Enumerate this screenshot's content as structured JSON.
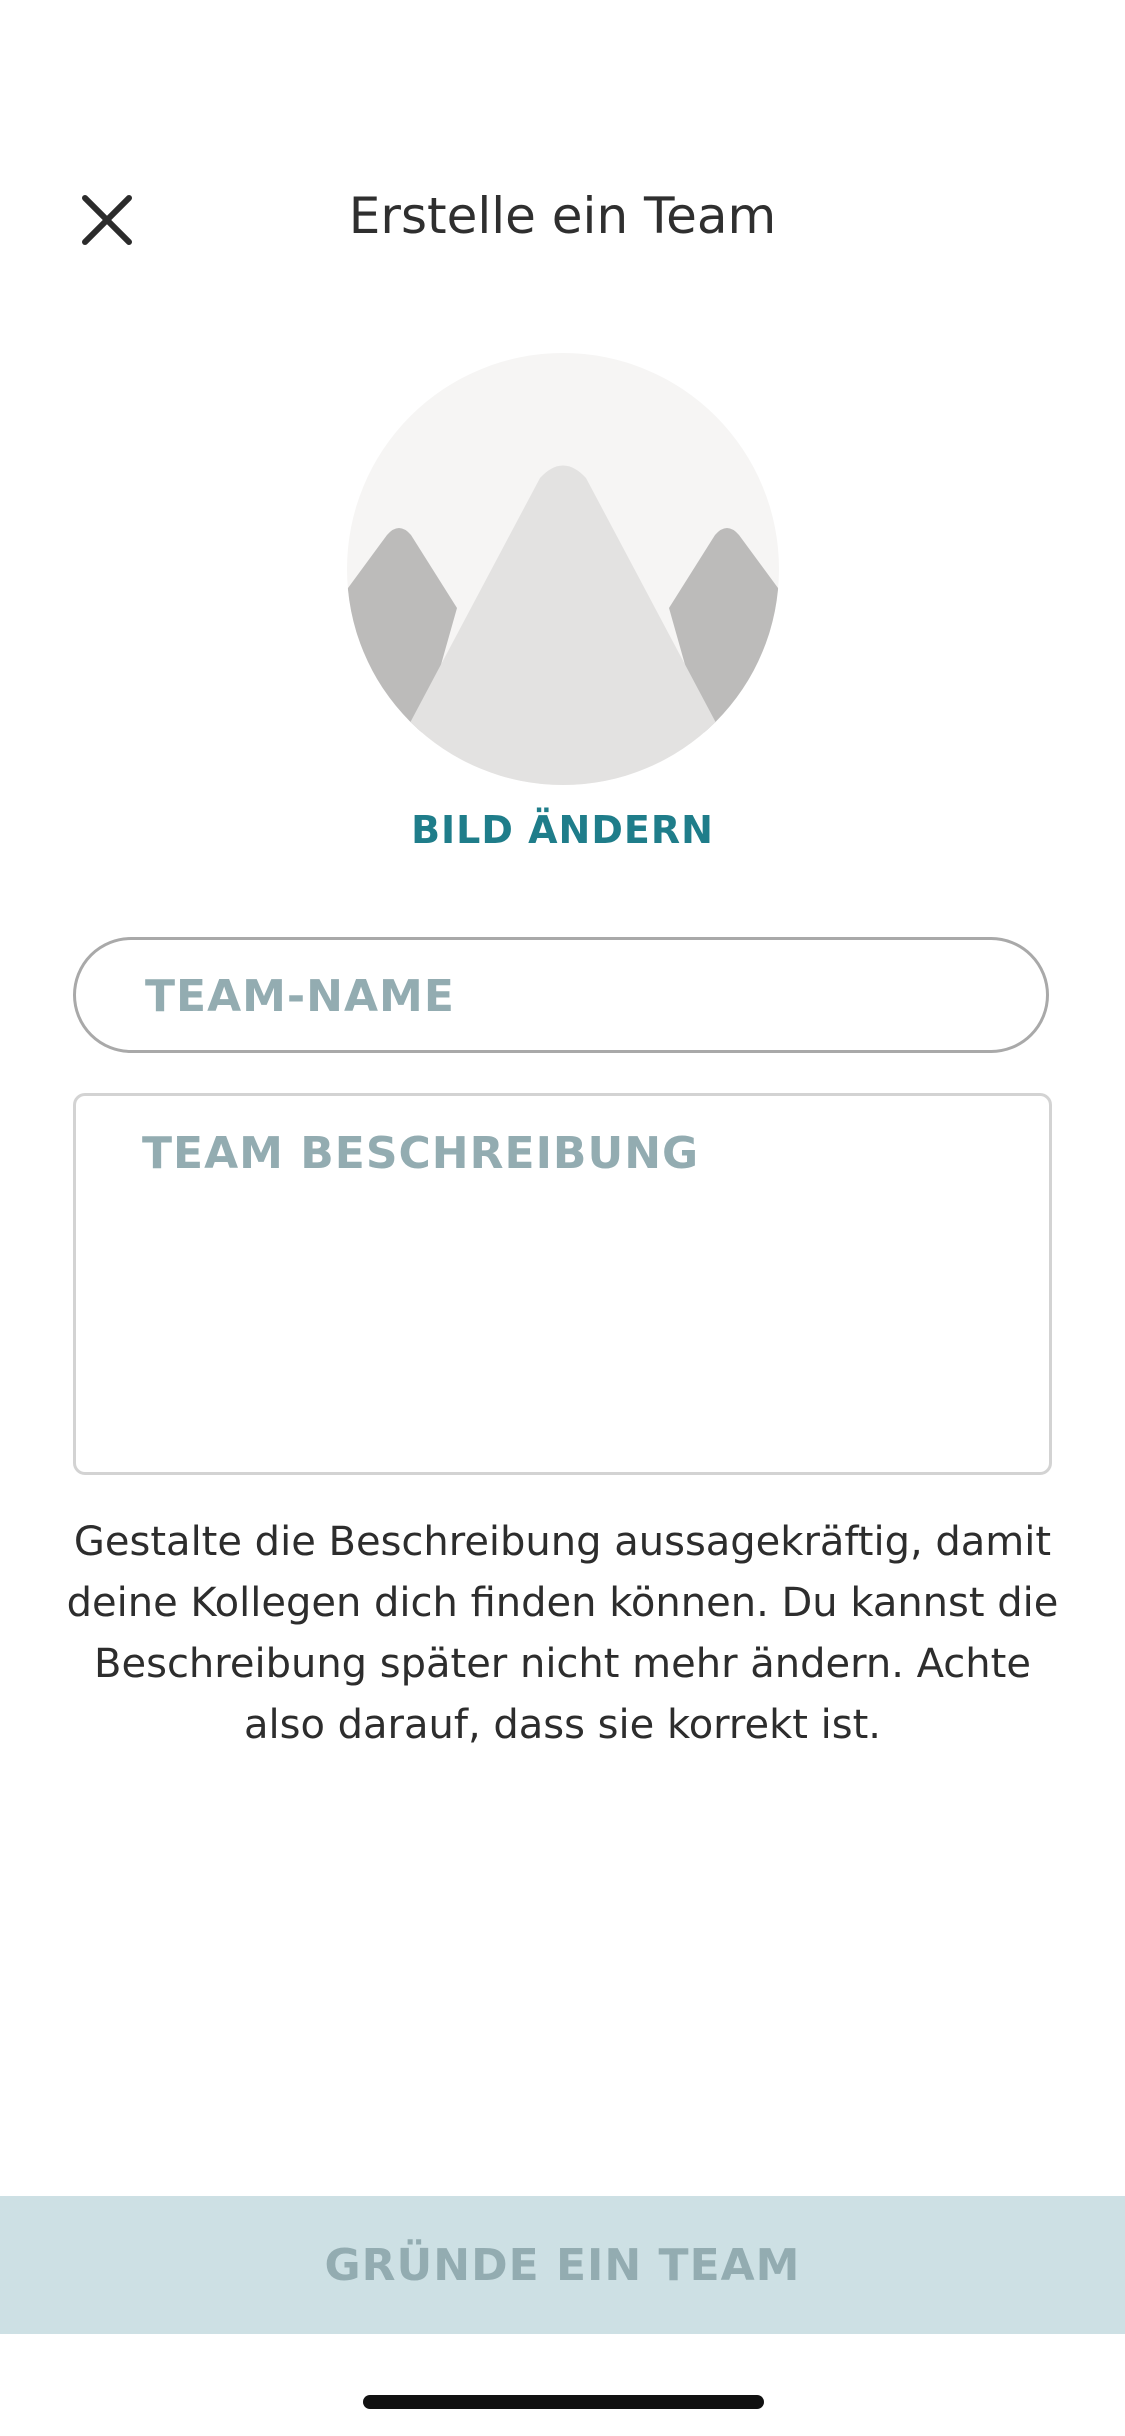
{
  "header": {
    "title": "Erstelle ein Team",
    "close_icon": "close-icon"
  },
  "avatar": {
    "icon": "mountain-placeholder-icon",
    "change_label": "BILD ÄNDERN",
    "colors": {
      "background": "#f6f5f4",
      "center_peak": "#e3e2e1",
      "side_peaks": "#bcbbba"
    }
  },
  "form": {
    "name_placeholder": "TEAM-NAME",
    "name_value": "",
    "description_placeholder": "TEAM BESCHREIBUNG",
    "description_value": ""
  },
  "hint_text": "Gestalte die Beschreibung aussagekräftig, damit deine Kollegen dich finden können. Du kannst die Beschreibung später nicht mehr ändern. Achte also darauf, dass sie korrekt ist.",
  "submit": {
    "label": "GRÜNDE EIN TEAM",
    "enabled": false
  },
  "colors": {
    "accent": "#1f7d8a",
    "placeholder": "#93acb1",
    "button_disabled_bg": "#cde0e4"
  }
}
